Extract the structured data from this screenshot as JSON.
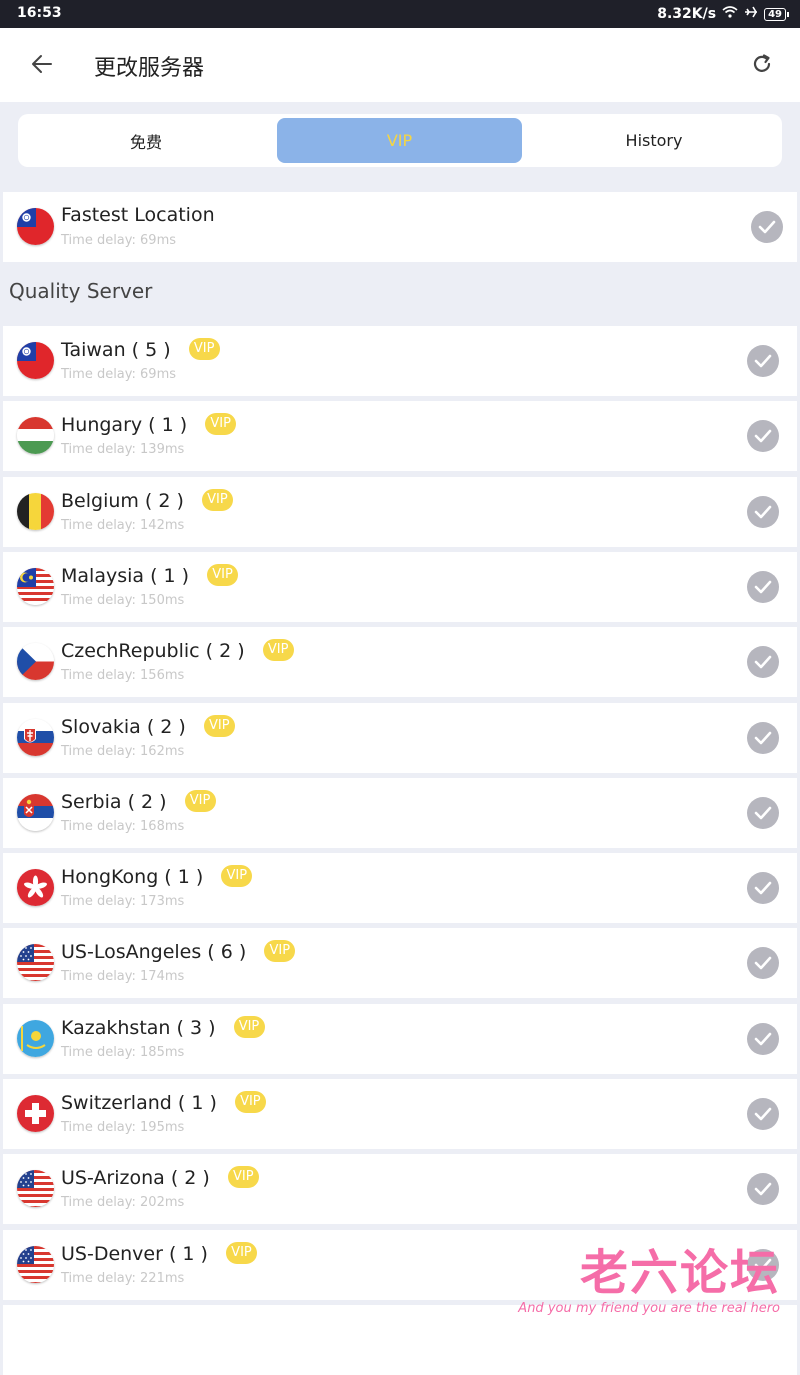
{
  "status_bar": {
    "time": "16:53",
    "speed": "8.32K/s",
    "battery": "49"
  },
  "header": {
    "title": "更改服务器"
  },
  "tabs": [
    {
      "label": "免费"
    },
    {
      "label": "VIP"
    },
    {
      "label": "History"
    }
  ],
  "fastest": {
    "name": "Fastest Location",
    "delay": "Time delay: 69ms",
    "flag": "taiwan"
  },
  "section_title": "Quality Server",
  "vip_badge": "VIP",
  "servers": [
    {
      "name": "Taiwan ( 5 )",
      "delay": "Time delay: 69ms",
      "flag": "taiwan"
    },
    {
      "name": "Hungary ( 1 )",
      "delay": "Time delay: 139ms",
      "flag": "hungary"
    },
    {
      "name": "Belgium ( 2 )",
      "delay": "Time delay: 142ms",
      "flag": "belgium"
    },
    {
      "name": "Malaysia ( 1 )",
      "delay": "Time delay: 150ms",
      "flag": "malaysia"
    },
    {
      "name": "CzechRepublic ( 2 )",
      "delay": "Time delay: 156ms",
      "flag": "czech"
    },
    {
      "name": "Slovakia ( 2 )",
      "delay": "Time delay: 162ms",
      "flag": "slovakia"
    },
    {
      "name": "Serbia ( 2 )",
      "delay": "Time delay: 168ms",
      "flag": "serbia"
    },
    {
      "name": "HongKong ( 1 )",
      "delay": "Time delay: 173ms",
      "flag": "hongkong"
    },
    {
      "name": "US-LosAngeles ( 6 )",
      "delay": "Time delay: 174ms",
      "flag": "us"
    },
    {
      "name": "Kazakhstan ( 3 )",
      "delay": "Time delay: 185ms",
      "flag": "kazakhstan"
    },
    {
      "name": "Switzerland ( 1 )",
      "delay": "Time delay: 195ms",
      "flag": "switzerland"
    },
    {
      "name": "US-Arizona ( 2 )",
      "delay": "Time delay: 202ms",
      "flag": "us"
    },
    {
      "name": "US-Denver ( 1 )",
      "delay": "Time delay: 221ms",
      "flag": "us"
    }
  ],
  "watermark": {
    "title": "老六论坛",
    "subtitle": "And you my friend you are the real hero"
  },
  "colors": {
    "tab_active": "#8bb3e8",
    "vip_badge": "#f7d84a",
    "check": "#b6b6be",
    "watermark": "#f56da8"
  }
}
